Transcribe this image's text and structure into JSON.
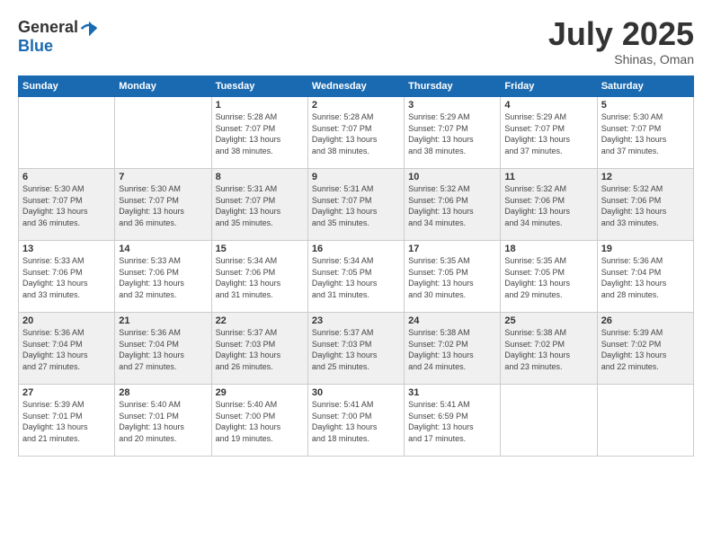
{
  "logo": {
    "general": "General",
    "blue": "Blue"
  },
  "title": {
    "month": "July 2025",
    "location": "Shinas, Oman"
  },
  "headers": [
    "Sunday",
    "Monday",
    "Tuesday",
    "Wednesday",
    "Thursday",
    "Friday",
    "Saturday"
  ],
  "weeks": [
    [
      {
        "day": "",
        "info": ""
      },
      {
        "day": "",
        "info": ""
      },
      {
        "day": "1",
        "info": "Sunrise: 5:28 AM\nSunset: 7:07 PM\nDaylight: 13 hours\nand 38 minutes."
      },
      {
        "day": "2",
        "info": "Sunrise: 5:28 AM\nSunset: 7:07 PM\nDaylight: 13 hours\nand 38 minutes."
      },
      {
        "day": "3",
        "info": "Sunrise: 5:29 AM\nSunset: 7:07 PM\nDaylight: 13 hours\nand 38 minutes."
      },
      {
        "day": "4",
        "info": "Sunrise: 5:29 AM\nSunset: 7:07 PM\nDaylight: 13 hours\nand 37 minutes."
      },
      {
        "day": "5",
        "info": "Sunrise: 5:30 AM\nSunset: 7:07 PM\nDaylight: 13 hours\nand 37 minutes."
      }
    ],
    [
      {
        "day": "6",
        "info": "Sunrise: 5:30 AM\nSunset: 7:07 PM\nDaylight: 13 hours\nand 36 minutes."
      },
      {
        "day": "7",
        "info": "Sunrise: 5:30 AM\nSunset: 7:07 PM\nDaylight: 13 hours\nand 36 minutes."
      },
      {
        "day": "8",
        "info": "Sunrise: 5:31 AM\nSunset: 7:07 PM\nDaylight: 13 hours\nand 35 minutes."
      },
      {
        "day": "9",
        "info": "Sunrise: 5:31 AM\nSunset: 7:07 PM\nDaylight: 13 hours\nand 35 minutes."
      },
      {
        "day": "10",
        "info": "Sunrise: 5:32 AM\nSunset: 7:06 PM\nDaylight: 13 hours\nand 34 minutes."
      },
      {
        "day": "11",
        "info": "Sunrise: 5:32 AM\nSunset: 7:06 PM\nDaylight: 13 hours\nand 34 minutes."
      },
      {
        "day": "12",
        "info": "Sunrise: 5:32 AM\nSunset: 7:06 PM\nDaylight: 13 hours\nand 33 minutes."
      }
    ],
    [
      {
        "day": "13",
        "info": "Sunrise: 5:33 AM\nSunset: 7:06 PM\nDaylight: 13 hours\nand 33 minutes."
      },
      {
        "day": "14",
        "info": "Sunrise: 5:33 AM\nSunset: 7:06 PM\nDaylight: 13 hours\nand 32 minutes."
      },
      {
        "day": "15",
        "info": "Sunrise: 5:34 AM\nSunset: 7:06 PM\nDaylight: 13 hours\nand 31 minutes."
      },
      {
        "day": "16",
        "info": "Sunrise: 5:34 AM\nSunset: 7:05 PM\nDaylight: 13 hours\nand 31 minutes."
      },
      {
        "day": "17",
        "info": "Sunrise: 5:35 AM\nSunset: 7:05 PM\nDaylight: 13 hours\nand 30 minutes."
      },
      {
        "day": "18",
        "info": "Sunrise: 5:35 AM\nSunset: 7:05 PM\nDaylight: 13 hours\nand 29 minutes."
      },
      {
        "day": "19",
        "info": "Sunrise: 5:36 AM\nSunset: 7:04 PM\nDaylight: 13 hours\nand 28 minutes."
      }
    ],
    [
      {
        "day": "20",
        "info": "Sunrise: 5:36 AM\nSunset: 7:04 PM\nDaylight: 13 hours\nand 27 minutes."
      },
      {
        "day": "21",
        "info": "Sunrise: 5:36 AM\nSunset: 7:04 PM\nDaylight: 13 hours\nand 27 minutes."
      },
      {
        "day": "22",
        "info": "Sunrise: 5:37 AM\nSunset: 7:03 PM\nDaylight: 13 hours\nand 26 minutes."
      },
      {
        "day": "23",
        "info": "Sunrise: 5:37 AM\nSunset: 7:03 PM\nDaylight: 13 hours\nand 25 minutes."
      },
      {
        "day": "24",
        "info": "Sunrise: 5:38 AM\nSunset: 7:02 PM\nDaylight: 13 hours\nand 24 minutes."
      },
      {
        "day": "25",
        "info": "Sunrise: 5:38 AM\nSunset: 7:02 PM\nDaylight: 13 hours\nand 23 minutes."
      },
      {
        "day": "26",
        "info": "Sunrise: 5:39 AM\nSunset: 7:02 PM\nDaylight: 13 hours\nand 22 minutes."
      }
    ],
    [
      {
        "day": "27",
        "info": "Sunrise: 5:39 AM\nSunset: 7:01 PM\nDaylight: 13 hours\nand 21 minutes."
      },
      {
        "day": "28",
        "info": "Sunrise: 5:40 AM\nSunset: 7:01 PM\nDaylight: 13 hours\nand 20 minutes."
      },
      {
        "day": "29",
        "info": "Sunrise: 5:40 AM\nSunset: 7:00 PM\nDaylight: 13 hours\nand 19 minutes."
      },
      {
        "day": "30",
        "info": "Sunrise: 5:41 AM\nSunset: 7:00 PM\nDaylight: 13 hours\nand 18 minutes."
      },
      {
        "day": "31",
        "info": "Sunrise: 5:41 AM\nSunset: 6:59 PM\nDaylight: 13 hours\nand 17 minutes."
      },
      {
        "day": "",
        "info": ""
      },
      {
        "day": "",
        "info": ""
      }
    ]
  ]
}
